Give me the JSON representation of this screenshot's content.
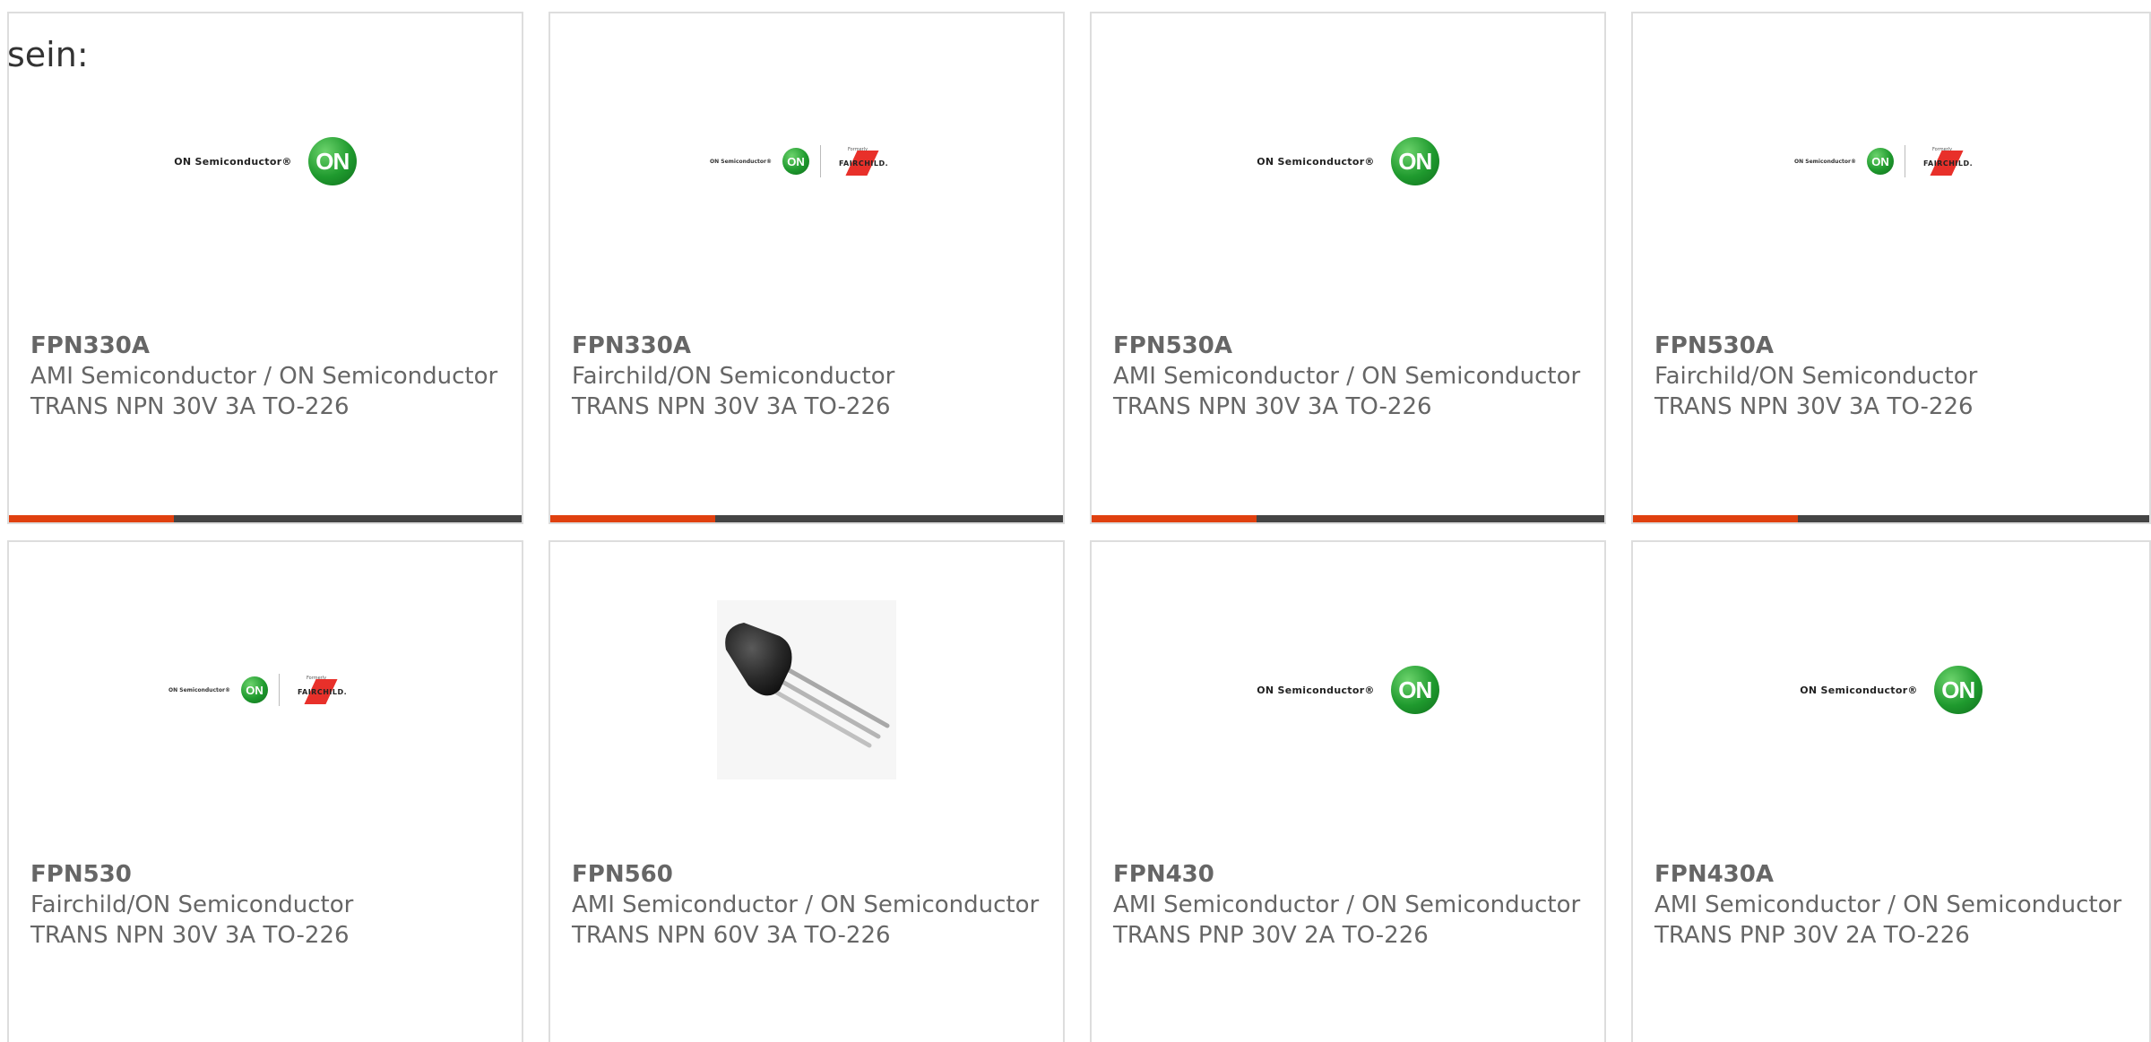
{
  "intro_text": "sein:",
  "colors": {
    "accent": "#e0400f",
    "bar_dark": "#444444",
    "border": "#dddddd",
    "text": "#666666"
  },
  "logo_text": {
    "on_wordmark": "ON Semiconductor®",
    "on_badge": "ON",
    "formerly": "Formerly",
    "fairchild": "FAIRCHILD."
  },
  "products": [
    {
      "part": "FPN330A",
      "manufacturer": "AMI Semiconductor / ON Semiconductor",
      "description": "TRANS NPN 30V 3A TO-226",
      "image": "on-semiconductor-logo"
    },
    {
      "part": "FPN330A",
      "manufacturer": "Fairchild/ON Semiconductor",
      "description": "TRANS NPN 30V 3A TO-226",
      "image": "on-fairchild-logo"
    },
    {
      "part": "FPN530A",
      "manufacturer": "AMI Semiconductor / ON Semiconductor",
      "description": "TRANS NPN 30V 3A TO-226",
      "image": "on-semiconductor-logo"
    },
    {
      "part": "FPN530A",
      "manufacturer": "Fairchild/ON Semiconductor",
      "description": "TRANS NPN 30V 3A TO-226",
      "image": "on-fairchild-logo"
    },
    {
      "part": "FPN530",
      "manufacturer": "Fairchild/ON Semiconductor",
      "description": "TRANS NPN 30V 3A TO-226",
      "image": "on-fairchild-logo"
    },
    {
      "part": "FPN560",
      "manufacturer": "AMI Semiconductor / ON Semiconductor",
      "description": "TRANS NPN 60V 3A TO-226",
      "image": "to-92-transistor-photo"
    },
    {
      "part": "FPN430",
      "manufacturer": "AMI Semiconductor / ON Semiconductor",
      "description": "TRANS PNP 30V 2A TO-226",
      "image": "on-semiconductor-logo"
    },
    {
      "part": "FPN430A",
      "manufacturer": "AMI Semiconductor / ON Semiconductor",
      "description": "TRANS PNP 30V 2A TO-226",
      "image": "on-semiconductor-logo"
    }
  ]
}
